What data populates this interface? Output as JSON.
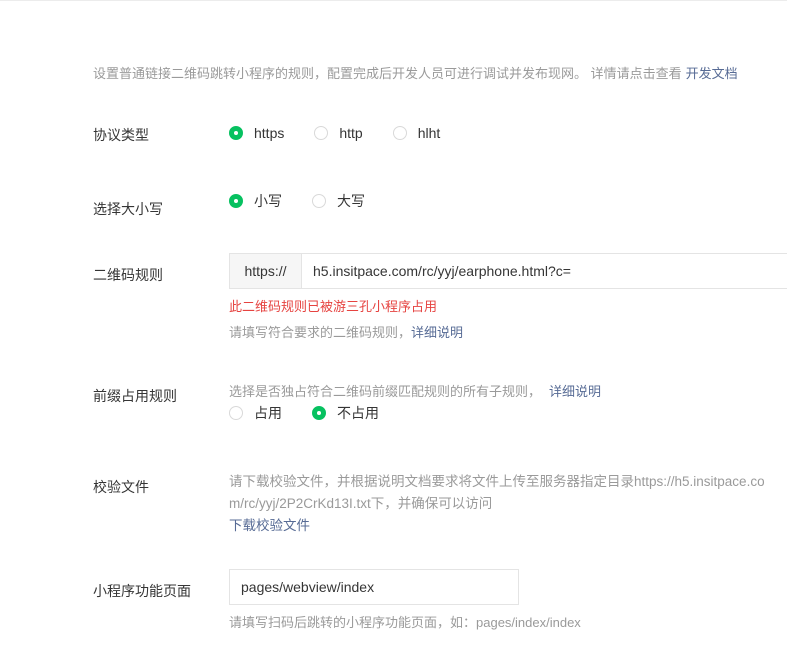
{
  "intro": {
    "text": "设置普通链接二维码跳转小程序的规则，配置完成后开发人员可进行调试并发布现网。 详情请点击查看",
    "link": "开发文档"
  },
  "protocol": {
    "label": "协议类型",
    "options": [
      "https",
      "http",
      "hlht"
    ],
    "selected": "https"
  },
  "case": {
    "label": "选择大小写",
    "options": [
      "小写",
      "大写"
    ],
    "selected": "小写"
  },
  "qr_rule": {
    "label": "二维码规则",
    "prefix": "https://",
    "value": "h5.insitpace.com/rc/yyj/earphone.html?c=",
    "error": "此二维码规则已被游三孔小程序占用",
    "tip": "请填写符合要求的二维码规则，",
    "tip_link": "详细说明"
  },
  "prefix_rule": {
    "label": "前缀占用规则",
    "desc": "选择是否独占符合二维码前缀匹配规则的所有子规则，",
    "desc_link": "详细说明",
    "options": [
      "占用",
      "不占用"
    ],
    "selected": "不占用"
  },
  "verify_file": {
    "label": "校验文件",
    "line1": "请下载校验文件，并根据说明文档要求将文件上传至服务器指定目录https://h5.insitpace.co",
    "line2": "m/rc/yyj/2P2CrKd13I.txt下，并确保可以访问",
    "download_link": "下载校验文件"
  },
  "page": {
    "label": "小程序功能页面",
    "value": "pages/webview/index",
    "tip": "请填写扫码后跳转的小程序功能页面，如：pages/index/index"
  },
  "colors": {
    "accent": "#07c160",
    "link": "#576b95",
    "error": "#e64340",
    "muted": "#9a9a9a"
  }
}
